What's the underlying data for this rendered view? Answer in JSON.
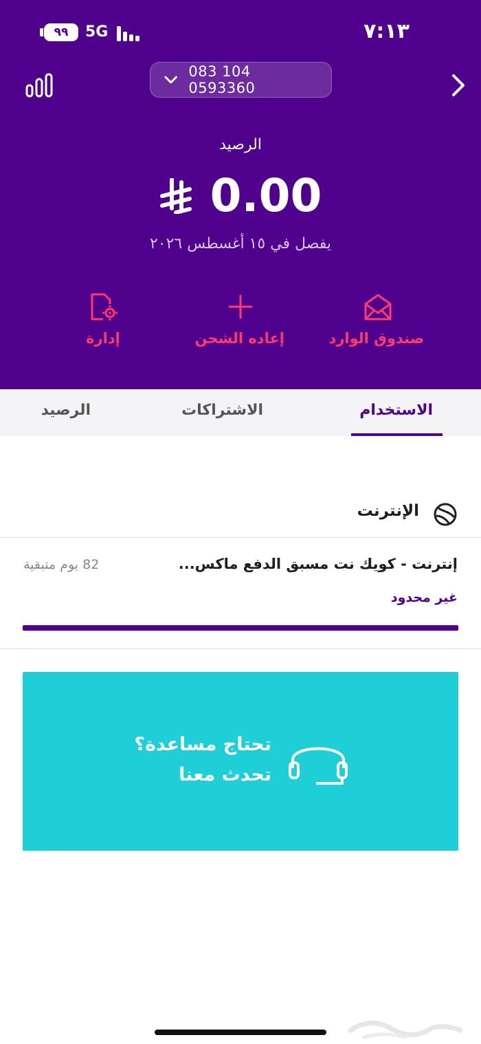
{
  "status_bar": {
    "time": "٧:١٣",
    "battery": "٩٩",
    "network": "5G"
  },
  "header": {
    "phone_number": "083 104 0593360",
    "balance_label": "الرصيد",
    "balance_amount": "0.00",
    "expiry_text": "يفصل في ١٥ أغسطس ٢٠٢٦"
  },
  "actions": {
    "inbox_label": "صندوق الوارد",
    "recharge_label": "إعاده الشحن",
    "manage_label": "إدارة"
  },
  "tabs": {
    "usage": "الاستخدام",
    "subscriptions": "الاشتراكات",
    "balance": "الرصيد"
  },
  "internet": {
    "title": "الإنترنت",
    "plan_name": "إنترنت - كويك نت مسبق الدفع ماكس...",
    "days_remaining": "82 يوم متبقية",
    "allowance": "غير محدود",
    "progress_fraction": 1.0
  },
  "help": {
    "title": "تحتاج مساعدة؟",
    "subtitle": "تحدث معنا"
  },
  "colors": {
    "brand_purple": "#4f008c",
    "action_pink": "#ff3b6b",
    "help_teal": "#1fcfd8"
  },
  "icons": {
    "chart": "bar-chart-icon",
    "chevron_right": "chevron-right-icon",
    "chevron_down": "chevron-down-icon",
    "inbox": "envelope-open-icon",
    "recharge": "plus-icon",
    "manage": "document-gear-icon",
    "internet": "globe-icon",
    "help": "headset-icon"
  }
}
